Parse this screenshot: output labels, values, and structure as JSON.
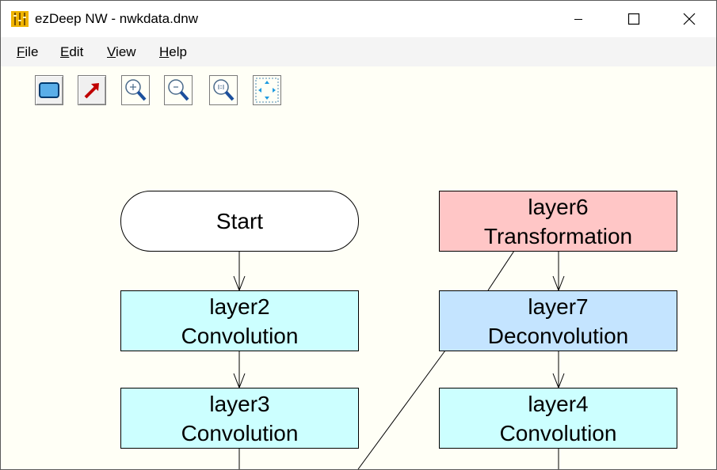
{
  "window": {
    "title": "ezDeep NW - nwkdata.dnw"
  },
  "menu": [
    {
      "label": "File"
    },
    {
      "label": "Edit"
    },
    {
      "label": "View"
    },
    {
      "label": "Help"
    }
  ],
  "toolbar": [
    {
      "icon": "rectangle-tool-icon"
    },
    {
      "icon": "arrow-tool-icon"
    },
    {
      "icon": "zoom-in-icon"
    },
    {
      "icon": "zoom-out-icon"
    },
    {
      "icon": "zoom-actual-size-icon"
    },
    {
      "icon": "fit-to-window-icon"
    }
  ],
  "diagram": {
    "nodes": {
      "start": {
        "label": "Start",
        "color": "#ffffff"
      },
      "layer2": {
        "name": "layer2",
        "type": "Convolution",
        "color": "#ccffff"
      },
      "layer3": {
        "name": "layer3",
        "type": "Convolution",
        "color": "#ccffff"
      },
      "layer6": {
        "name": "layer6",
        "type": "Transformation",
        "color": "#ffc6c6"
      },
      "layer7": {
        "name": "layer7",
        "type": "Deconvolution",
        "color": "#c4e4ff"
      },
      "layer4": {
        "name": "layer4",
        "type": "Convolution",
        "color": "#ccffff"
      }
    },
    "edges": [
      {
        "from": "start",
        "to": "layer2"
      },
      {
        "from": "layer2",
        "to": "layer3"
      },
      {
        "from": "layer6",
        "to": "layer7"
      },
      {
        "from": "layer7",
        "to": "layer4"
      }
    ]
  }
}
